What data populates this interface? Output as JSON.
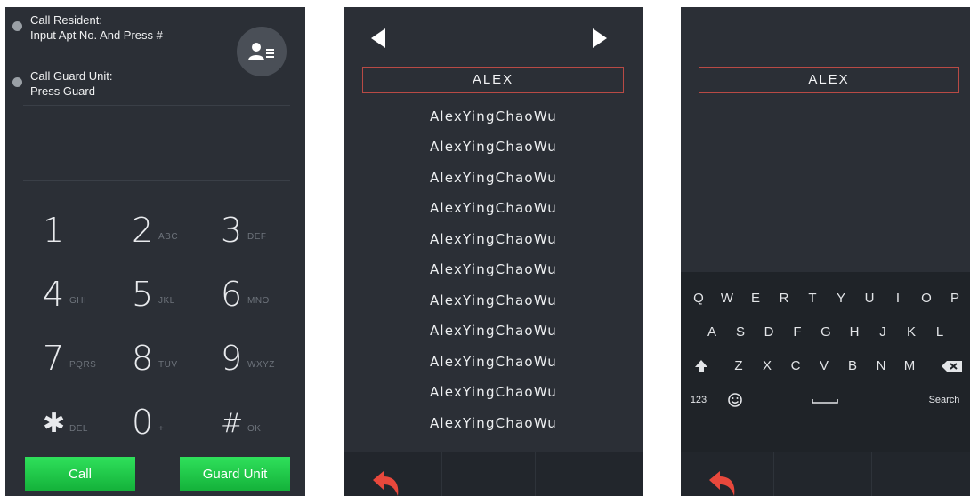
{
  "screen1": {
    "instruction1": {
      "title": "Call Resident:",
      "detail": "Input Apt No. And Press #"
    },
    "instruction2": {
      "title": "Call Guard Unit:",
      "detail": "Press Guard"
    },
    "contact_icon": "contacts-icon",
    "keys": [
      {
        "digit": "1",
        "letters": ""
      },
      {
        "digit": "2",
        "letters": "ABC"
      },
      {
        "digit": "3",
        "letters": "DEF"
      },
      {
        "digit": "4",
        "letters": "GHI"
      },
      {
        "digit": "5",
        "letters": "JKL"
      },
      {
        "digit": "6",
        "letters": "MNO"
      },
      {
        "digit": "7",
        "letters": "PQRS"
      },
      {
        "digit": "8",
        "letters": "TUV"
      },
      {
        "digit": "9",
        "letters": "WXYZ"
      },
      {
        "digit": "✱",
        "letters": "DEL"
      },
      {
        "digit": "0",
        "letters": "+"
      },
      {
        "digit": "#",
        "letters": "OK"
      }
    ],
    "call_label": "Call",
    "guard_label": "Guard Unit",
    "button_color": "#1ec846"
  },
  "screen2": {
    "search_value": "ALEX",
    "results": [
      "AlexYingChaoWu",
      "AlexYingChaoWu",
      "AlexYingChaoWu",
      "AlexYingChaoWu",
      "AlexYingChaoWu",
      "AlexYingChaoWu",
      "AlexYingChaoWu",
      "AlexYingChaoWu",
      "AlexYingChaoWu",
      "AlexYingChaoWu",
      "AlexYingChaoWu"
    ],
    "back_color": "#e8483c"
  },
  "screen3": {
    "search_value": "ALEX",
    "keyboard": {
      "row1": [
        "Q",
        "W",
        "E",
        "R",
        "T",
        "Y",
        "U",
        "I",
        "O",
        "P"
      ],
      "row2": [
        "A",
        "S",
        "D",
        "F",
        "G",
        "H",
        "J",
        "K",
        "L"
      ],
      "row3": [
        "Z",
        "X",
        "C",
        "V",
        "B",
        "N",
        "M"
      ],
      "numbers_label": "123",
      "search_label": "Search"
    }
  }
}
